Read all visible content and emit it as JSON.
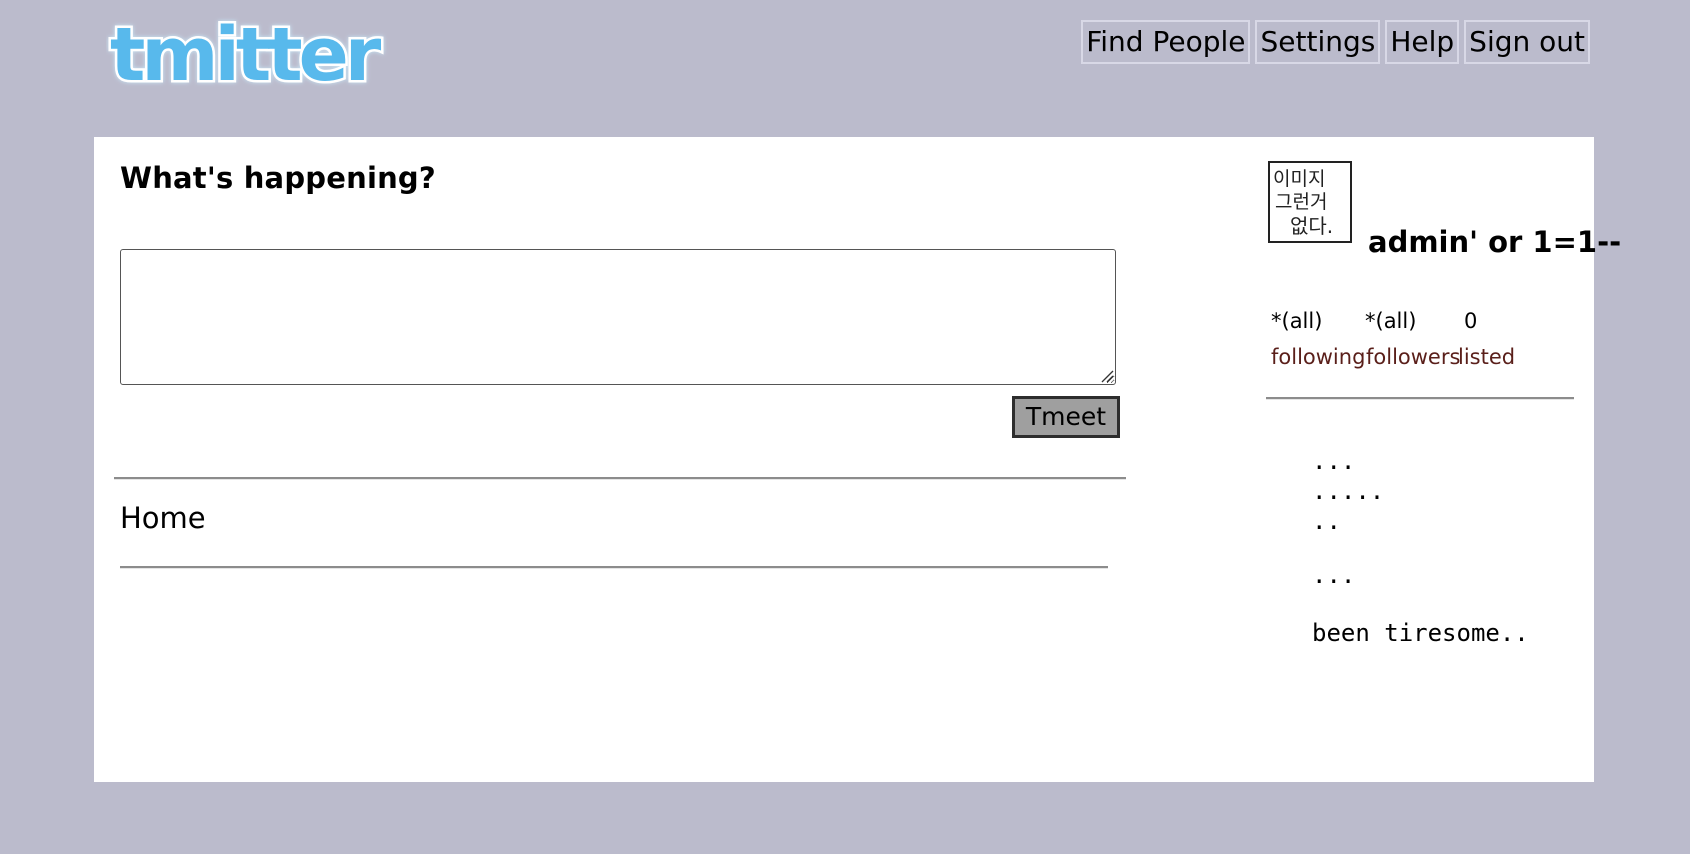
{
  "brand": {
    "logo_text": "tmitter"
  },
  "nav": {
    "find_people": "Find People",
    "settings": "Settings",
    "help": "Help",
    "sign_out": "Sign out"
  },
  "composer": {
    "heading": "What's happening?",
    "value": "",
    "button_label": "Tmeet"
  },
  "timeline": {
    "title": "Home"
  },
  "profile": {
    "avatar_text": [
      "이미지",
      "그런거",
      "없다."
    ],
    "username": "admin' or 1=1--",
    "stats": [
      {
        "value": "*(all)",
        "label": "following"
      },
      {
        "value": "*(all)",
        "label": "followers"
      },
      {
        "value": "0",
        "label": "listed"
      }
    ]
  },
  "sidebar_text": [
    "...",
    ".....",
    "..",
    "...",
    "been tiresome.."
  ],
  "colors": {
    "page_bg": "#bbbbcc",
    "logo_blue": "#58b9ec",
    "stat_label": "#5a1f1a"
  }
}
